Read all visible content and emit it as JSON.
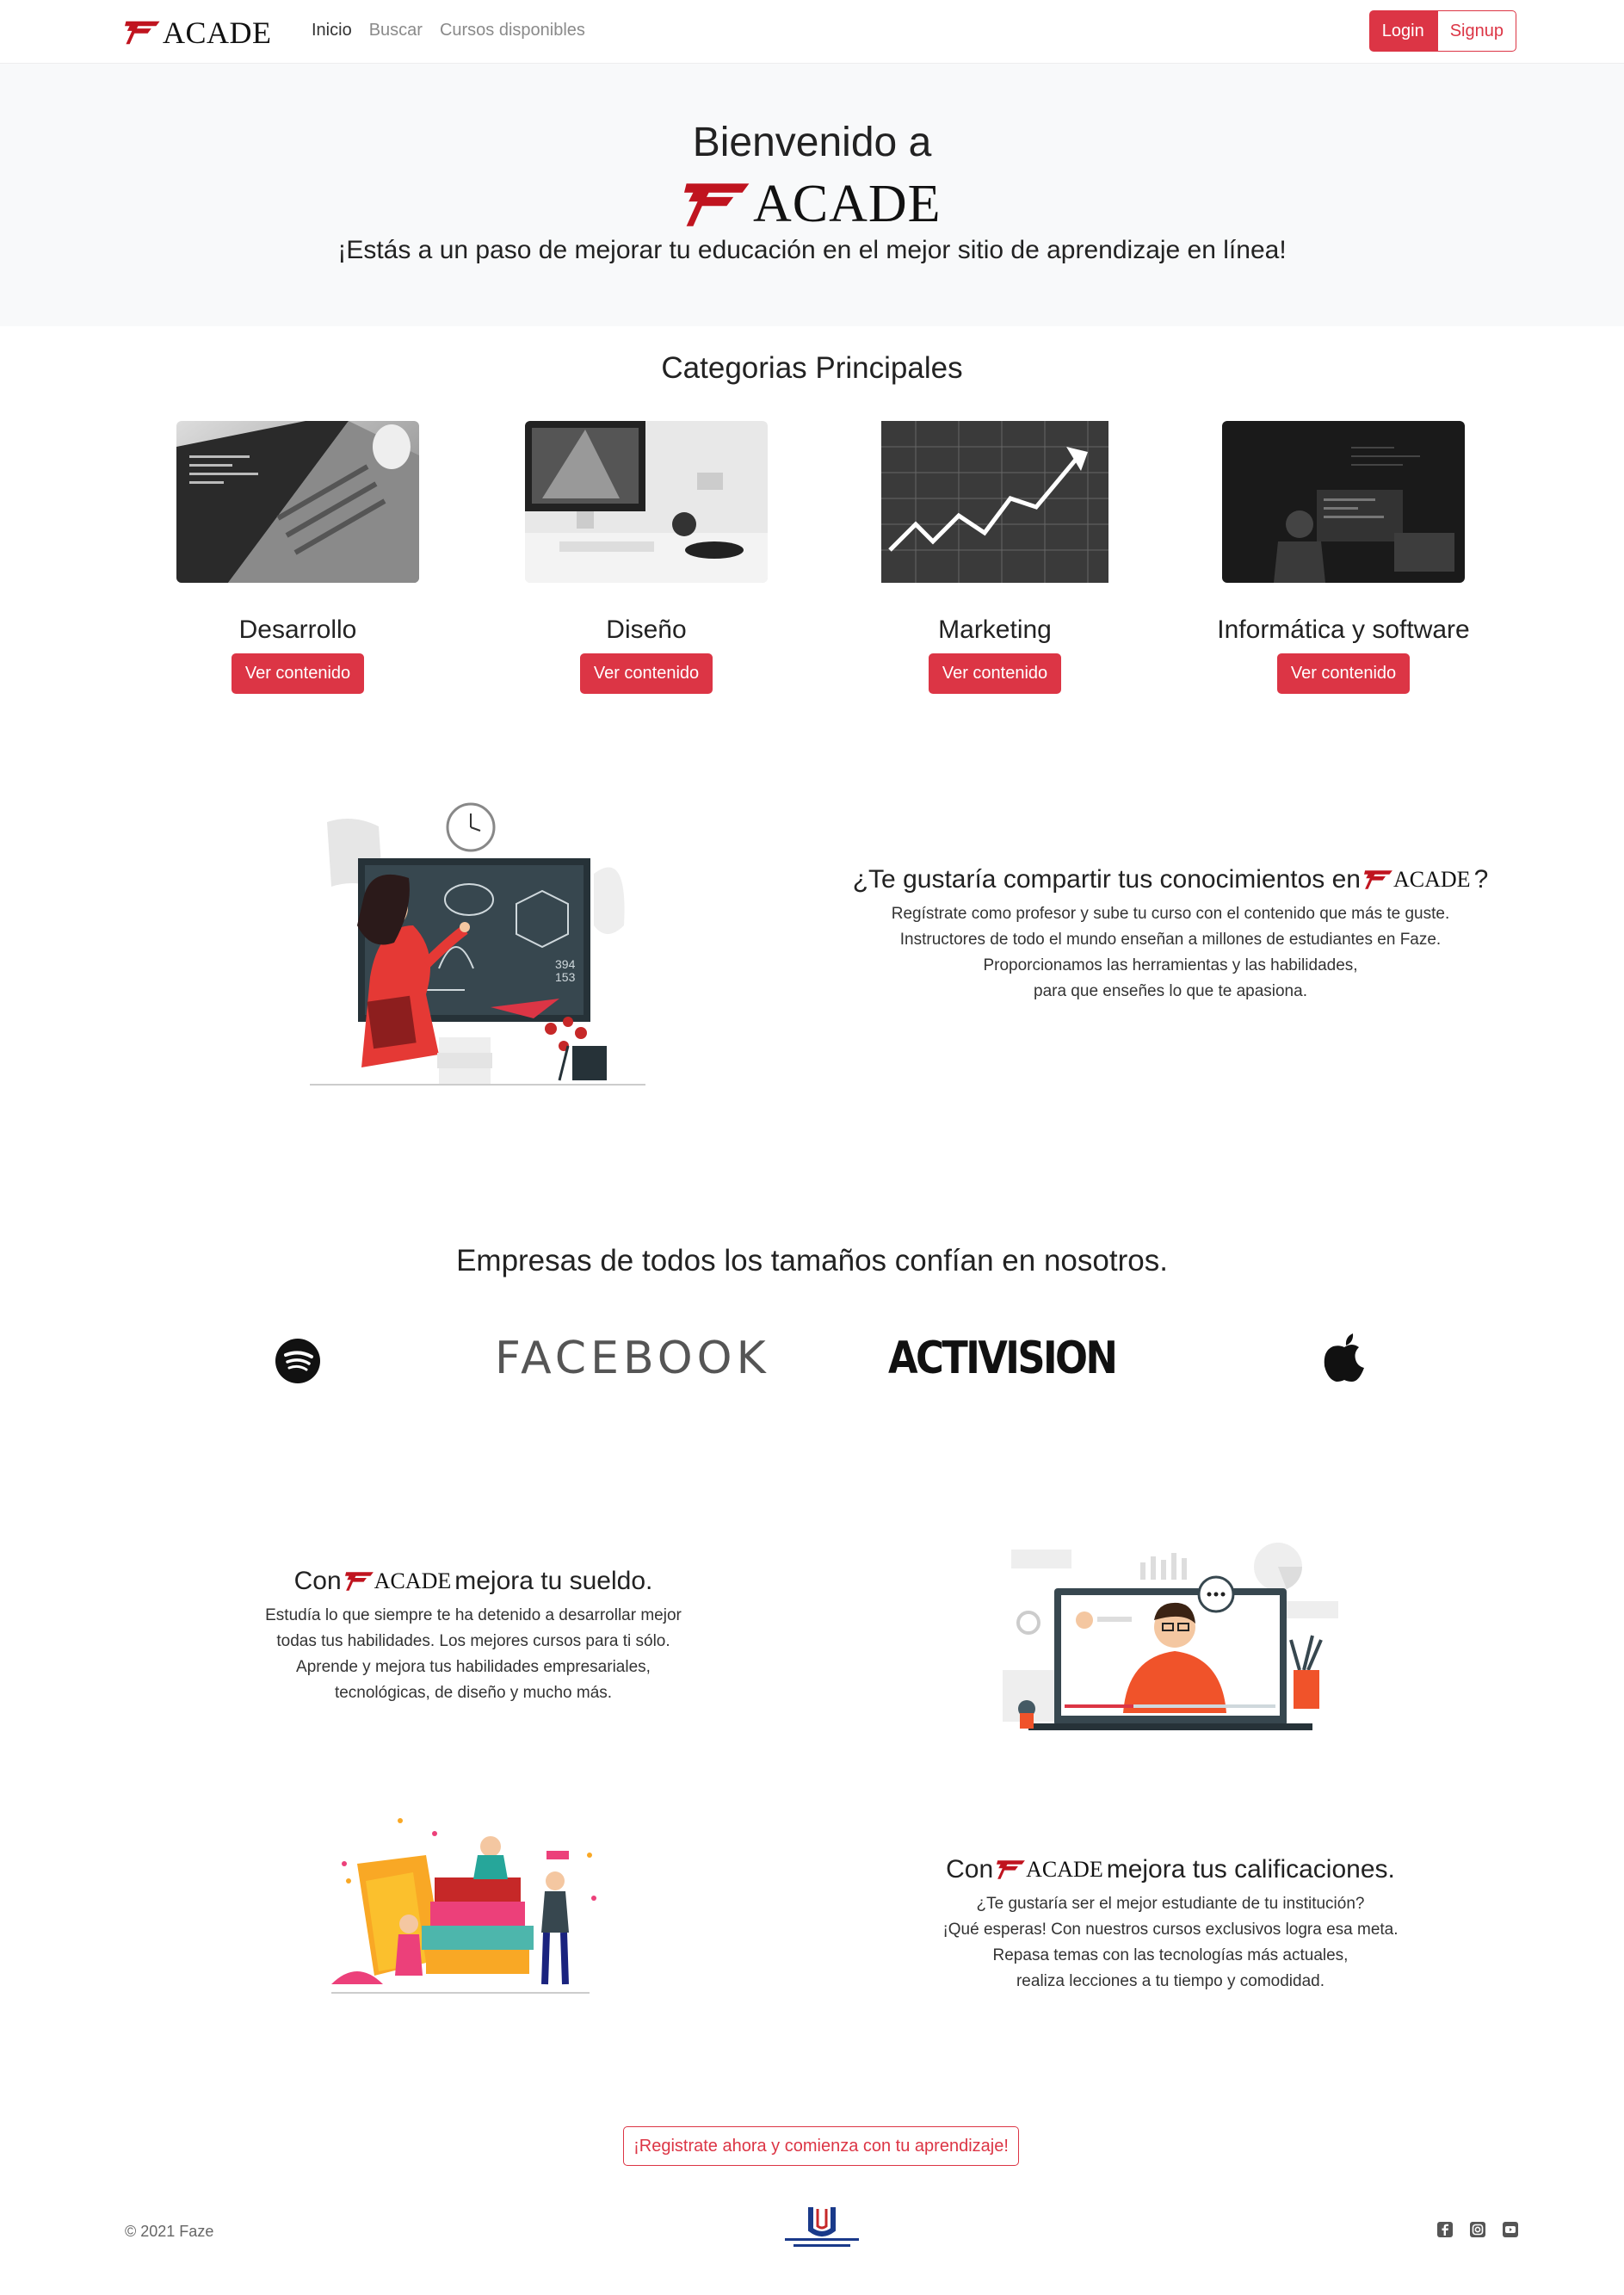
{
  "brand": {
    "name": "ACADE",
    "accent": "#dc3545",
    "mark_color": "#c0141f"
  },
  "nav": {
    "links": [
      "Inicio",
      "Buscar",
      "Cursos disponibles"
    ],
    "active": "Inicio",
    "login_label": "Login",
    "signup_label": "Signup"
  },
  "hero": {
    "title": "Bienvenido a",
    "subtitle": "¡Estás a un paso de mejorar tu educación en el mejor sitio de aprendizaje en línea!"
  },
  "categories": {
    "title": "Categorias Principales",
    "items": [
      {
        "name": "Desarrollo",
        "button": "Ver contenido",
        "image": "laptop-photo"
      },
      {
        "name": "Diseño",
        "button": "Ver contenido",
        "image": "desk-imac-photo"
      },
      {
        "name": "Marketing",
        "button": "Ver contenido",
        "image": "stock-chart-photo"
      },
      {
        "name": "Informática y software",
        "button": "Ver contenido",
        "image": "person-computer-photo"
      }
    ]
  },
  "teach": {
    "title_before": "¿Te gustaría compartir tus conocimientos en",
    "title_after": "?",
    "lines": [
      "Regístrate como profesor y sube tu curso con el contenido que más te guste.",
      "Instructores de todo el mundo enseñan a millones de estudiantes en Faze.",
      "Proporcionamos las herramientas y las habilidades,",
      "para que enseñes lo que te apasiona."
    ]
  },
  "companies": {
    "title": "Empresas de todos los tamaños confían en nosotros.",
    "logos": [
      {
        "name": "spotify-logo",
        "text": ""
      },
      {
        "name": "facebook-logo",
        "text": "FACEBOOK"
      },
      {
        "name": "activision-logo",
        "text": "ACTIVISION"
      },
      {
        "name": "apple-logo",
        "text": ""
      }
    ]
  },
  "salary": {
    "title_before": "Con",
    "title_after": "mejora tu sueldo.",
    "lines": [
      "Estudía lo que siempre te ha detenido a desarrollar mejor",
      "todas tus habilidades. Los mejores cursos para ti sólo.",
      "Aprende y mejora tus habilidades empresariales,",
      "tecnológicas, de diseño y mucho más."
    ]
  },
  "grades": {
    "title_before": "Con",
    "title_after": "mejora tus calificaciones.",
    "lines": [
      "¿Te gustaría ser el mejor estudiante de tu institución?",
      "¡Qué esperas! Con nuestros cursos exclusivos logra esa meta.",
      "Repasa temas con las tecnologías más actuales,",
      "realiza lecciones a tu tiempo y comodidad."
    ]
  },
  "cta": {
    "label": "¡Registrate ahora y comienza con tu aprendizaje!"
  },
  "footer": {
    "copyright": "© 2021 Faze",
    "icons": [
      "facebook-icon",
      "instagram-icon",
      "youtube-icon"
    ]
  }
}
